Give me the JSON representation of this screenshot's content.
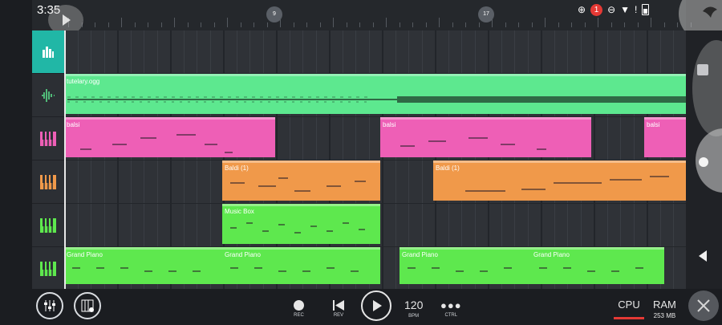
{
  "status_bar": {
    "time": "3:35",
    "notification_count": "1"
  },
  "timeline": {
    "bar_markers": [
      "9",
      "17"
    ]
  },
  "tracks": [
    {
      "id": "master",
      "icon": "mixer-bars-icon",
      "color": "#21b7a6"
    },
    {
      "id": "audio",
      "icon": "waveform-icon",
      "color": "#5de88f"
    },
    {
      "id": "pink",
      "icon": "piano-keys-icon",
      "color": "#ee5fb6"
    },
    {
      "id": "orange",
      "icon": "piano-keys-icon",
      "color": "#f0994a"
    },
    {
      "id": "green1",
      "icon": "piano-keys-icon",
      "color": "#5ee84e"
    },
    {
      "id": "green2",
      "icon": "piano-keys-icon",
      "color": "#5ee84e"
    }
  ],
  "clips": {
    "audio": [
      {
        "name": "tutelary.ogg"
      }
    ],
    "pink": [
      {
        "name": "balsi"
      },
      {
        "name": "balsi"
      },
      {
        "name": "balsi"
      }
    ],
    "orange": [
      {
        "name": "Baldi (1)"
      },
      {
        "name": "Baldi (1)"
      }
    ],
    "green1": [
      {
        "name": "Music Box"
      }
    ],
    "green2": [
      {
        "name": "Grand Piano"
      },
      {
        "name": "Grand Piano"
      },
      {
        "name": "Grand Piano"
      },
      {
        "name": "Grand Piano"
      }
    ]
  },
  "transport": {
    "rec_label": "REC",
    "rev_label": "REV",
    "bpm_value": "120",
    "bpm_label": "BPM",
    "ctrl_label": "CTRL"
  },
  "meters": {
    "cpu_label": "CPU",
    "ram_label": "RAM",
    "ram_value": "253 MB"
  },
  "colors": {
    "master": "#21b7a6",
    "audio_clip": "#5de88f",
    "pink_clip": "#ee5fb6",
    "orange_clip": "#f0994a",
    "green_clip": "#5ee84e",
    "cpu_underline": "#e53935"
  }
}
